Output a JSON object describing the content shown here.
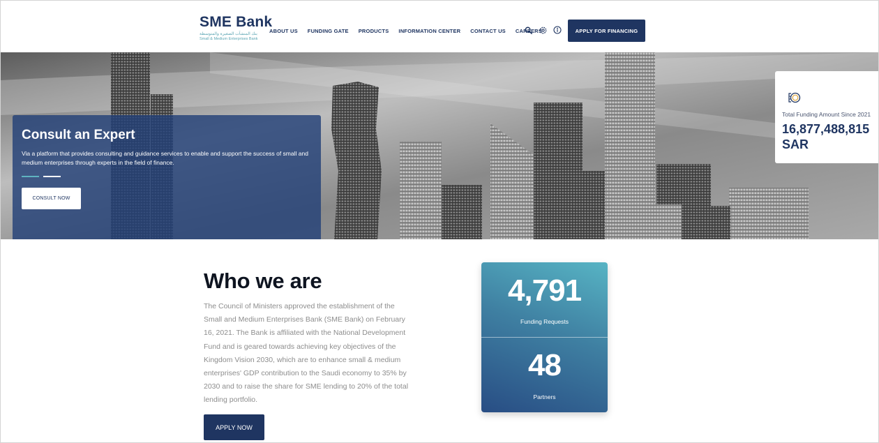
{
  "header": {
    "logo_title": "SME Bank",
    "logo_arabic": "بنك المنشآت الصغيرة والمتوسطة",
    "logo_english": "Small & Medium Enterprises Bank",
    "nav": [
      "ABOUT US",
      "FUNDING GATE",
      "PRODUCTS",
      "INFORMATION CENTER",
      "CONTACT US",
      "CAREERS"
    ],
    "icons": [
      "search-icon",
      "settings-icon",
      "accessibility-icon"
    ],
    "cta_label": "APPLY FOR FINANCING"
  },
  "hero": {
    "consult": {
      "title": "Consult an Expert",
      "text": "Via a platform that provides consulting and guidance services to enable and support the success of small and medium enterprises through experts in the field of finance.",
      "button_label": "CONSULT NOW",
      "slides": 2,
      "active_slide": 1
    },
    "funding": {
      "label": "Total Funding Amount Since 2021",
      "value": "16,877,488,815",
      "currency": "SAR"
    }
  },
  "who": {
    "title": "Who we are",
    "text": "The Council of Ministers approved the establishment of the Small and Medium Enterprises Bank (SME Bank) on February 16, 2021. The Bank is affiliated with the National Development Fund and is geared towards achieving key objectives of the Kingdom Vision 2030, which are to enhance small & medium enterprises' GDP contribution to the Saudi economy to 35% by 2030 and to raise the share for SME lending to 20% of the total lending portfolio.",
    "button_label": "APPLY NOW"
  },
  "stats": [
    {
      "value": "4,791",
      "label": "Funding Requests"
    },
    {
      "value": "48",
      "label": "Partners"
    }
  ],
  "colors": {
    "brand_navy": "#1f3561",
    "accent_teal": "#5fb3c0"
  }
}
